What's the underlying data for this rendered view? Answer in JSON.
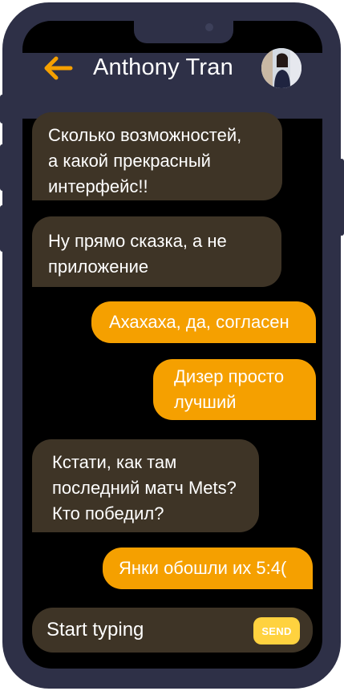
{
  "header": {
    "title": "Anthony Tran",
    "back_icon": "arrow-left-icon",
    "avatar_icon": "contact-avatar"
  },
  "messages": [
    {
      "direction": "in",
      "text": "Сколько возможностей,\nа какой прекрасный\nинтерфейс!!"
    },
    {
      "direction": "in",
      "text": "Ну прямо сказка, а не\nприложение"
    },
    {
      "direction": "out",
      "text": "Ахахаха, да, согласен"
    },
    {
      "direction": "out",
      "text": "Дизер просто\nлучший"
    },
    {
      "direction": "in",
      "text": "Кстати, как там\nпоследний матч Mets?\nКто победил?"
    },
    {
      "direction": "out",
      "text": "Янки обошли их 5:4("
    }
  ],
  "composer": {
    "placeholder": "Start typing",
    "value": "",
    "send_label": "SEND"
  },
  "colors": {
    "device_frame": "#2e3047",
    "screen_background": "#000000",
    "incoming_bubble": "#3e3426",
    "outgoing_bubble": "#f5a000",
    "accent": "#f5a000",
    "send_button": "#ffd23f"
  }
}
